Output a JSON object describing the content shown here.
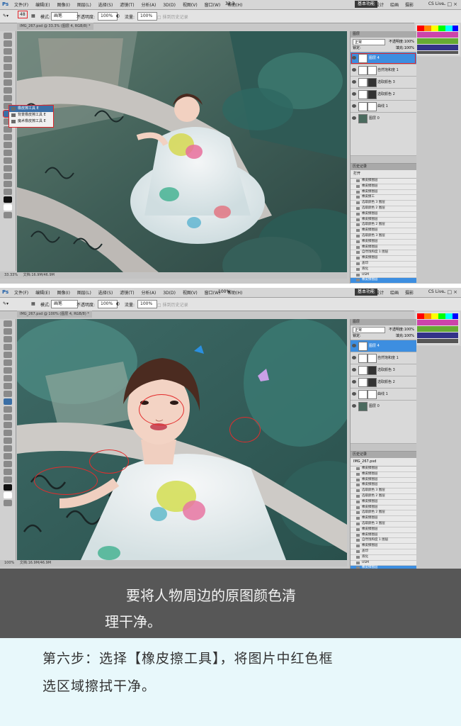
{
  "screenshot1": {
    "ps_logo": "Ps",
    "menu": [
      "文件(F)",
      "编辑(E)",
      "图像(I)",
      "图层(L)",
      "选择(S)",
      "滤镜(T)",
      "分析(A)",
      "3D(D)",
      "视图(V)",
      "窗口(W)",
      "帮助(H)"
    ],
    "workspace": "基本功能",
    "workspace_tabs": [
      "设计",
      "绘画",
      "摄影"
    ],
    "cs_live": "CS Live",
    "zoom_top": "33.3",
    "options": {
      "brush_size": "48",
      "mode_label": "模式:",
      "mode_value": "画笔",
      "opacity_label": "不透明度:",
      "opacity_value": "100%",
      "flow_label": "流量:",
      "flow_value": "100%",
      "erase_history": "抹到历史记录"
    },
    "doc_tab": "IMG_267.psd @ 33.3% (图层 4, RGB/8) *",
    "status_zoom": "33.33%",
    "status_doc": "文档:16.9M/46.9M",
    "tool_flyout": [
      "橡皮擦工具",
      "背景橡皮擦工具",
      "魔术橡皮擦工具"
    ],
    "tool_flyout_keys": [
      "E",
      "E",
      "E"
    ],
    "layers_panel": {
      "title": "图层",
      "blend_mode": "正常",
      "opacity_label": "不透明度:",
      "opacity_value": "100%",
      "lock_label": "锁定:",
      "fill_label": "填充:",
      "fill_value": "100%",
      "layers": [
        "图层 4",
        "自然饱和度 1",
        "选取颜色 3",
        "选取颜色 2",
        "曲线 1",
        "图层 0"
      ]
    },
    "history_panel": {
      "title": "历史记录",
      "snapshot": "打开",
      "items": [
        "橡皮擦图层",
        "橡皮擦图层",
        "橡皮擦图层",
        "橡皮擦工",
        "选取颜色 3 图层",
        "选取颜色 2 图层",
        "橡皮擦图层",
        "橡皮擦图层",
        "选取颜色 2 图层",
        "橡皮擦图层",
        "选取颜色 3 图层",
        "橡皮擦图层",
        "橡皮擦图层",
        "自然饱和度 1 图层",
        "橡皮擦图层",
        "盖印",
        "液化",
        "USM",
        "橡皮擦图层"
      ]
    }
  },
  "screenshot2": {
    "ps_logo": "Ps",
    "menu": [
      "文件(F)",
      "编辑(E)",
      "图像(I)",
      "图层(L)",
      "选择(S)",
      "滤镜(T)",
      "分析(A)",
      "3D(D)",
      "视图(V)",
      "窗口(W)",
      "帮助(H)"
    ],
    "workspace": "基本功能",
    "workspace_tabs": [
      "设计",
      "绘画",
      "摄影"
    ],
    "cs_live": "CS Live",
    "zoom_top": "100%",
    "options": {
      "mode_label": "模式:",
      "mode_value": "画笔",
      "opacity_label": "不透明度:",
      "opacity_value": "100%",
      "flow_label": "流量:",
      "flow_value": "100%",
      "erase_history": "抹到历史记录"
    },
    "doc_tab": "IMG_267.psd @ 100% (图层 4, RGB/8) *",
    "status_zoom": "100%",
    "status_doc": "文档:16.9M/46.9M",
    "layers_panel": {
      "title": "图层",
      "blend_mode": "正常",
      "opacity_label": "不透明度:",
      "opacity_value": "100%",
      "lock_label": "锁定:",
      "fill_label": "填充:",
      "fill_value": "100%",
      "layers": [
        "图层 4",
        "自然饱和度 1",
        "选取颜色 3",
        "选取颜色 2",
        "曲线 1",
        "图层 0"
      ]
    },
    "history_panel": {
      "title": "历史记录",
      "snapshot": "IMG_267.psd",
      "items": [
        "橡皮擦图层",
        "橡皮擦图层",
        "橡皮擦图层",
        "橡皮擦图层",
        "选取颜色 3 图层",
        "选取颜色 2 图层",
        "橡皮擦图层",
        "橡皮擦图层",
        "选取颜色 2 图层",
        "橡皮擦图层",
        "选取颜色 3 图层",
        "橡皮擦图层",
        "橡皮擦图层",
        "自然饱和度 1 图层",
        "橡皮擦图层",
        "盖印",
        "液化",
        "USM",
        "橡皮擦图层"
      ]
    }
  },
  "caption": {
    "line1": "要将人物周边的原图颜色清",
    "line2": "理干净。"
  },
  "instruction": {
    "line1": "第六步：选择【橡皮擦工具】，将图片中红色框",
    "line2": "选区域擦拭干净。"
  },
  "colors": {
    "highlight": "#e0262b",
    "selection_blue": "#3d8ee0",
    "caption_bg": "#575757",
    "instruction_bg": "#e8f8fb"
  }
}
